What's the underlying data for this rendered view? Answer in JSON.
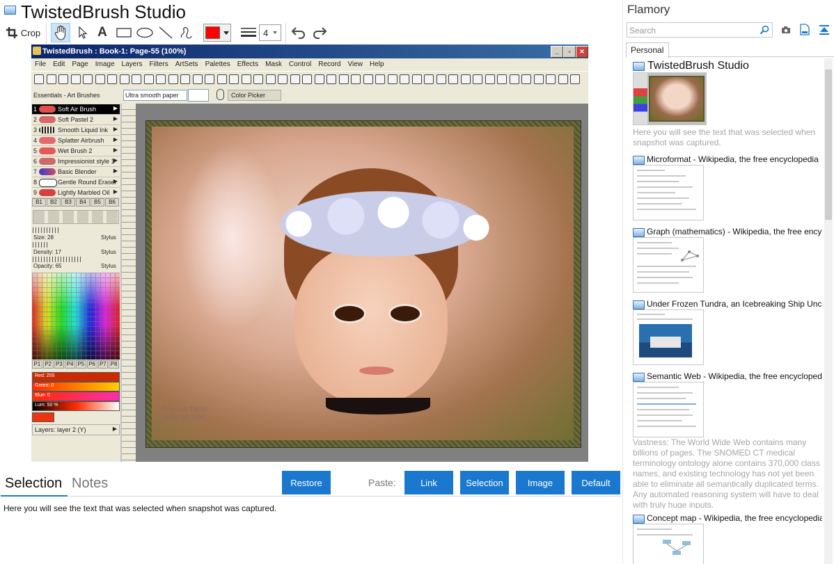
{
  "app": {
    "title": "TwistedBrush Studio"
  },
  "toolbar": {
    "crop_label": "Crop",
    "text_tool_glyph": "A",
    "line_width_value": "4",
    "accent_color": "#ff0000"
  },
  "screenshot": {
    "window_title": "TwistedBrush : Book-1: Page-55 (100%)",
    "menu": [
      "File",
      "Edit",
      "Page",
      "Image",
      "Layers",
      "Filters",
      "ArtSets",
      "Palettes",
      "Effects",
      "Mask",
      "Control",
      "Record",
      "View",
      "Help"
    ],
    "artset_label": "Essentials - Art Brushes",
    "paper_select": "Ultra smooth paper",
    "picker_label": "Color Picker",
    "brushes": [
      {
        "num": "1",
        "name": "Soft Air Brush",
        "color": "#e05050"
      },
      {
        "num": "2",
        "name": "Soft Pastel 2",
        "color": "#d86868"
      },
      {
        "num": "3",
        "name": "Smooth Liquid Ink",
        "color": "#222222"
      },
      {
        "num": "4",
        "name": "Splatter Airbrush",
        "color": "#e26a6a"
      },
      {
        "num": "5",
        "name": "Wet Brush 2",
        "color": "#e45858"
      },
      {
        "num": "6",
        "name": "Impressionist style 1",
        "color": "#cc6a6a"
      },
      {
        "num": "7",
        "name": "Basic Blender",
        "color": "#6a4a9a"
      },
      {
        "num": "8",
        "name": "Gentle Round Eraser",
        "color": "#222222"
      },
      {
        "num": "9",
        "name": "Lightly Marbled Oil",
        "color": "#d84040"
      }
    ],
    "banks": [
      "B1",
      "B2",
      "B3",
      "B4",
      "B5",
      "B6"
    ],
    "size_label": "Size: 28",
    "density_label": "Density: 17",
    "opacity_label": "Opacity: 65",
    "stylus_label": "Stylus",
    "palette_tabs": [
      "P1",
      "P2",
      "P3",
      "P4",
      "P5",
      "P6",
      "P7",
      "P8"
    ],
    "color_sliders": [
      {
        "label": "Red: 255",
        "color": "#cc2a00"
      },
      {
        "label": "Green: 0",
        "color": "#ff7a00"
      },
      {
        "label": "Blue: 0",
        "color": "#ff2d8a"
      },
      {
        "label": "Lum: 50 %",
        "color": "#d15030"
      }
    ],
    "current_color": "#ee3311",
    "layers_label": "Layers: layer 2 (Y)",
    "signature_line1": "Princess Daisy",
    "signature_line2": "SqIM 10/2006"
  },
  "bottom": {
    "tab_selection": "Selection",
    "tab_notes": "Notes",
    "restore_button": "Restore",
    "paste_label": "Paste:",
    "paste_buttons": [
      "Link",
      "Selection",
      "Image",
      "Default"
    ],
    "selection_text": "Here you will see the text that was selected when snapshot was captured."
  },
  "flamory": {
    "title": "Flamory",
    "search_placeholder": "Search",
    "tab_personal": "Personal",
    "snapshots": [
      {
        "title": "TwistedBrush Studio",
        "desc": "Here you will see the text that was selected when snapshot was captured."
      },
      {
        "title": "Microformat - Wikipedia, the free encyclopedia"
      },
      {
        "title": "Graph (mathematics) - Wikipedia, the free ency"
      },
      {
        "title": "Under Frozen Tundra, an Icebreaking Ship Unco"
      },
      {
        "title": "Semantic Web - Wikipedia, the free encycloped",
        "desc": "Vastness: The World Wide Web contains many billions of pages. The SNOMED CT medical terminology ontology alone contains 370,000 class names, and existing technology has not yet been able to eliminate all semantically duplicated terms. Any automated reasoning system will have to deal with truly huge inputs."
      },
      {
        "title": "Concept map - Wikipedia, the free encyclopedia"
      }
    ]
  }
}
